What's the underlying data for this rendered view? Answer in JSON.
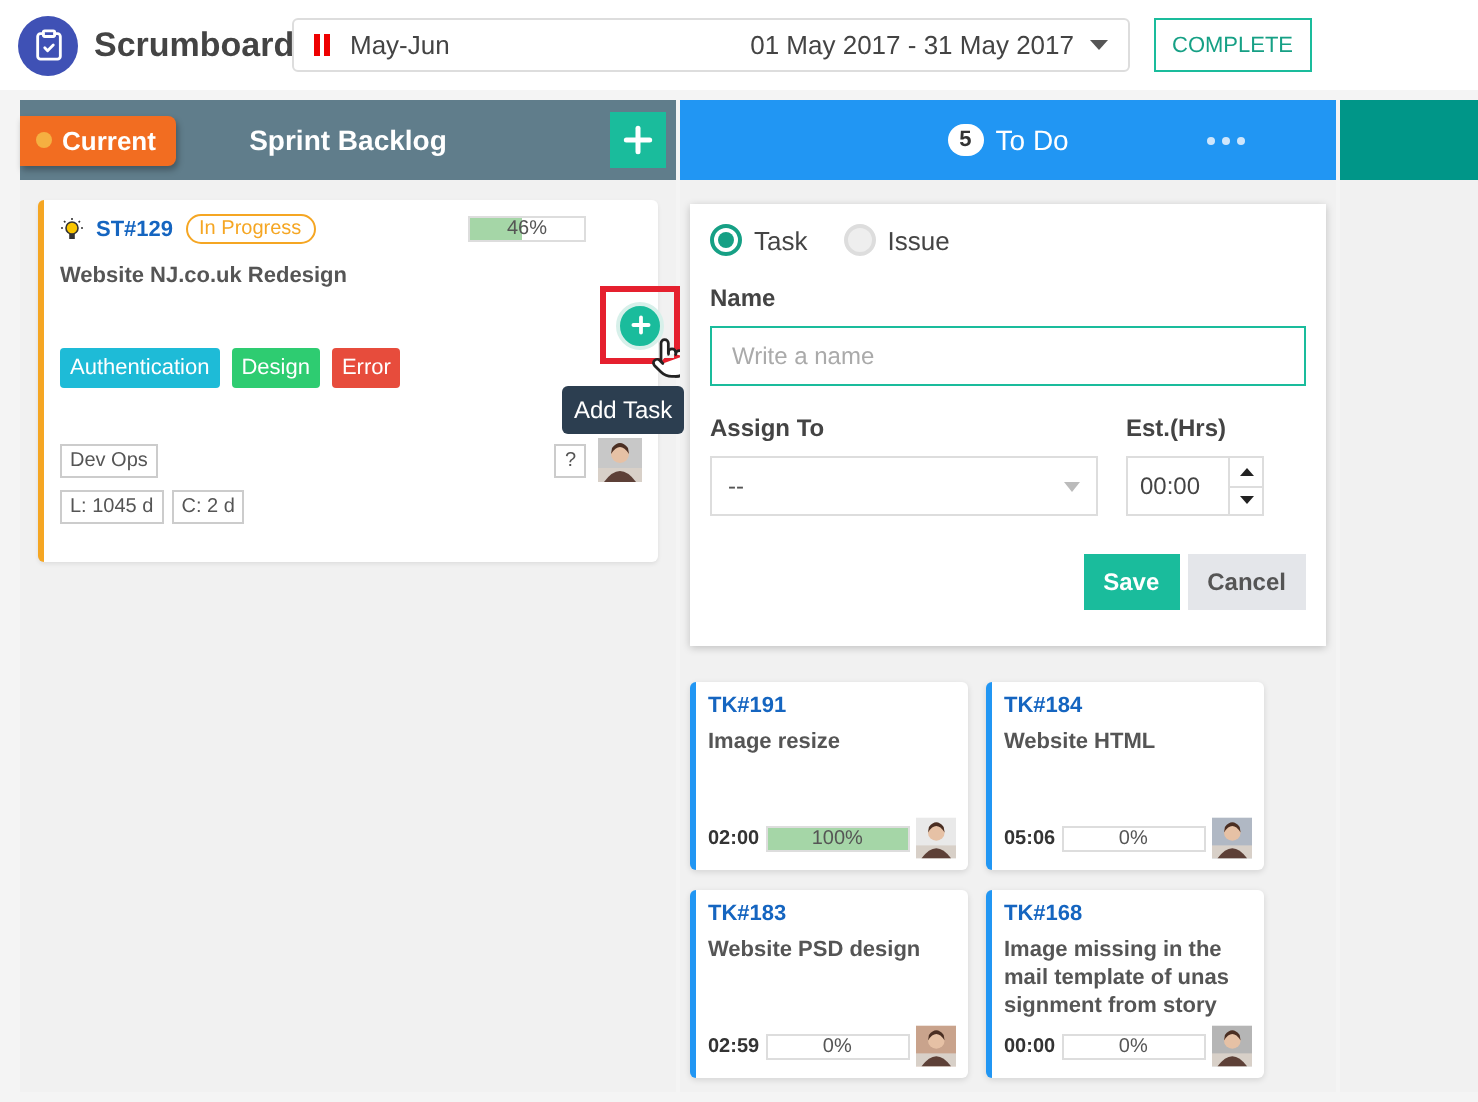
{
  "app": {
    "title": "Scrumboard"
  },
  "sprint_selector": {
    "name": "May-Jun",
    "dates": "01 May 2017 - 31 May 2017"
  },
  "complete_button": "COMPLETE",
  "columns": [
    {
      "title": "Sprint Backlog",
      "badge": "Current",
      "color": "#607d8b"
    },
    {
      "title": "To Do",
      "count": "5",
      "color": "#2196f3"
    },
    {
      "color": "#009688"
    }
  ],
  "story": {
    "id": "ST#129",
    "status": "In Progress",
    "level": 0.46,
    "reading": "46%",
    "title": "Website NJ.co.uk Redesign",
    "tags": [
      {
        "label": "Authentication",
        "color": "#1ebbd7"
      },
      {
        "label": "Design",
        "color": "#2ecc71"
      },
      {
        "label": "Error",
        "color": "#e74c3c"
      }
    ],
    "team": "Dev Ops",
    "help": "?",
    "lead_time": "L: 1045 d",
    "cycle_time": "C: 2 d"
  },
  "tooltip": "Add Task",
  "form": {
    "types": [
      {
        "label": "Task",
        "selected": true
      },
      {
        "label": "Issue",
        "selected": false
      }
    ],
    "name_label": "Name",
    "name_placeholder": "Write a name",
    "assign_label": "Assign To",
    "assign_value": "--",
    "estimate_label": "Est.(Hrs)",
    "estimate_value": "00:00",
    "buttons": [
      "Save",
      "Cancel"
    ]
  },
  "tasks": [
    {
      "id": "TK#191",
      "title": "Image resize",
      "time": "02:00",
      "level": 1,
      "reading": "100%"
    },
    {
      "id": "TK#184",
      "title": "Website HTML",
      "time": "05:06",
      "level": 0,
      "reading": "0%"
    },
    {
      "id": "TK#183",
      "title": "Website PSD design",
      "time": "02:59",
      "level": 0,
      "reading": "0%"
    },
    {
      "id": "TK#168",
      "title": "Image missing in the mail template of unas signment from story",
      "time": "00:00",
      "level": 0,
      "reading": "0%"
    }
  ]
}
